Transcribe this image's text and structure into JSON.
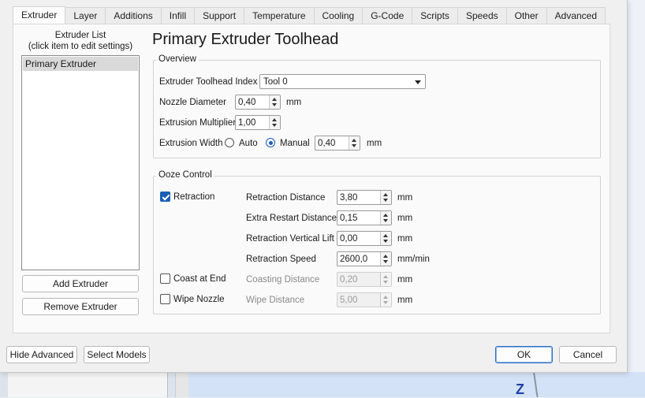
{
  "tabs": [
    "Extruder",
    "Layer",
    "Additions",
    "Infill",
    "Support",
    "Temperature",
    "Cooling",
    "G-Code",
    "Scripts",
    "Speeds",
    "Other",
    "Advanced"
  ],
  "active_tab": "Extruder",
  "extruder_list": {
    "header_line1": "Extruder List",
    "header_line2": "(click item to edit settings)",
    "items": [
      "Primary Extruder"
    ],
    "add_label": "Add Extruder",
    "remove_label": "Remove Extruder"
  },
  "page_title": "Primary Extruder Toolhead",
  "overview": {
    "title": "Overview",
    "toolhead_index_label": "Extruder Toolhead Index",
    "toolhead_index_value": "Tool 0",
    "nozzle_label": "Nozzle Diameter",
    "nozzle_value": "0,40",
    "nozzle_unit": "mm",
    "multiplier_label": "Extrusion Multiplier",
    "multiplier_value": "1,00",
    "width_label": "Extrusion Width",
    "width_auto_label": "Auto",
    "width_manual_label": "Manual",
    "width_mode": "Manual",
    "width_value": "0,40",
    "width_unit": "mm"
  },
  "ooze": {
    "title": "Ooze Control",
    "retraction_label": "Retraction",
    "retraction_checked": true,
    "coast_label": "Coast at End",
    "coast_checked": false,
    "wipe_label": "Wipe Nozzle",
    "wipe_checked": false,
    "retraction_distance_label": "Retraction Distance",
    "retraction_distance_value": "3,80",
    "retraction_distance_unit": "mm",
    "extra_restart_label": "Extra Restart Distance",
    "extra_restart_value": "0,15",
    "extra_restart_unit": "mm",
    "vertical_lift_label": "Retraction Vertical Lift",
    "vertical_lift_value": "0,00",
    "vertical_lift_unit": "mm",
    "retraction_speed_label": "Retraction Speed",
    "retraction_speed_value": "2600,0",
    "retraction_speed_unit": "mm/min",
    "coasting_label": "Coasting Distance",
    "coasting_value": "0,20",
    "coasting_unit": "mm",
    "wipe_distance_label": "Wipe Distance",
    "wipe_distance_value": "5,00",
    "wipe_distance_unit": "mm"
  },
  "footer": {
    "hide_advanced": "Hide Advanced",
    "select_models": "Select Models",
    "ok": "OK",
    "cancel": "Cancel"
  },
  "background": {
    "axis_label": "Z"
  },
  "colors": {
    "accent": "#1a5fb4",
    "default_button_border": "#2d6ec4"
  }
}
